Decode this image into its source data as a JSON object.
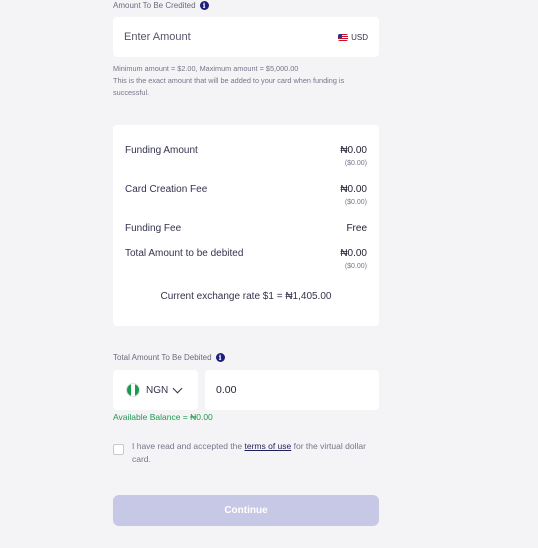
{
  "credit": {
    "label": "Amount To Be Credited",
    "placeholder": "Enter Amount",
    "currency": "USD",
    "hint_line1": "Minimum amount = $2.00, Maximum amount = $5,000.00",
    "hint_line2": "This is the exact amount that will be added to your card when funding is successful."
  },
  "summary": {
    "funding_amount_label": "Funding Amount",
    "funding_amount_value": "₦0.00",
    "funding_amount_usd": "($0.00)",
    "card_fee_label": "Card Creation Fee",
    "card_fee_value": "₦0.00",
    "card_fee_usd": "($0.00)",
    "funding_fee_label": "Funding Fee",
    "funding_fee_value": "Free",
    "total_label": "Total Amount to be debited",
    "total_value": "₦0.00",
    "total_usd": "($0.00)",
    "exchange_rate": "Current exchange rate $1 = ₦1,405.00"
  },
  "debit": {
    "label": "Total Amount To Be Debited",
    "currency": "NGN",
    "value": "0.00",
    "balance": "Available Balance = ₦0.00"
  },
  "terms": {
    "prefix": "I have read and accepted the ",
    "link": "terms of use",
    "suffix": " for the virtual dollar card."
  },
  "continue_label": "Continue",
  "colors": {
    "accent_disabled": "#c7c7e6",
    "success": "#1f9a4e",
    "info_icon": "#1f1f7a"
  }
}
